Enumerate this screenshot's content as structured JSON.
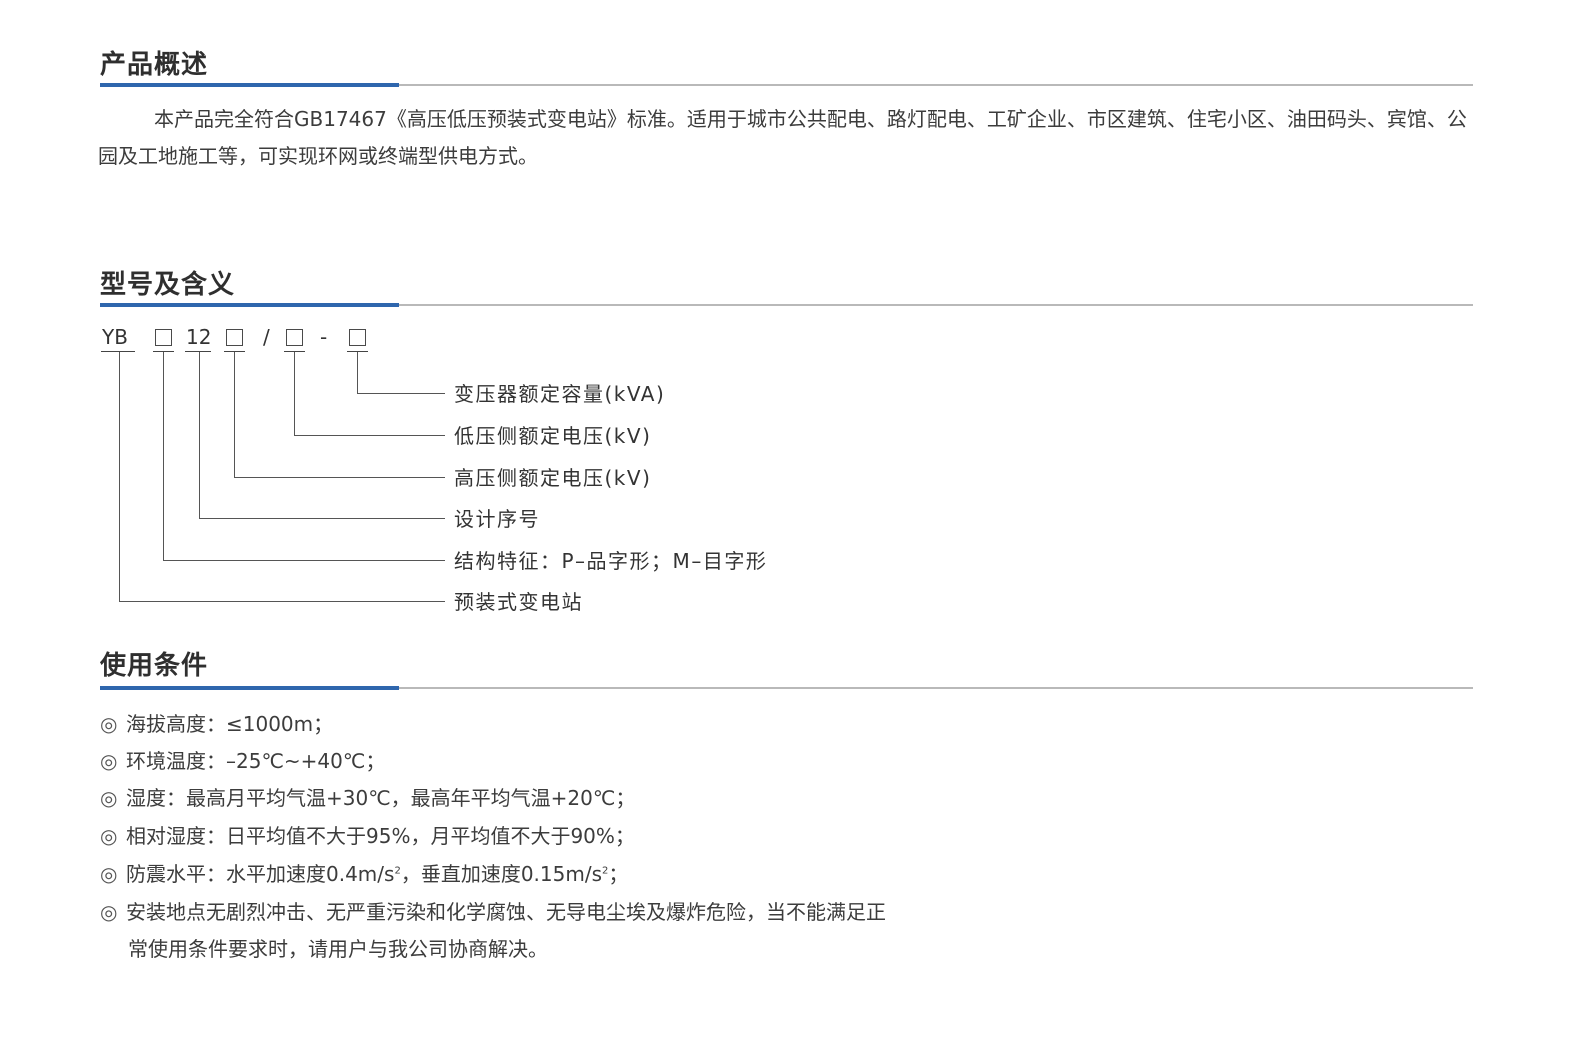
{
  "sections": {
    "overview_title": "产品概述",
    "model_title": "型号及含义",
    "conditions_title": "使用条件"
  },
  "overview": {
    "text": "本产品完全符合GB17467《高压低压预装式变电站》标准。适用于城市公共配电、路灯配电、工矿企业、市区建筑、住宅小区、油田码头、宾馆、公园及工地施工等，可实现环网或终端型供电方式。"
  },
  "model_code": {
    "prefix": "YB",
    "number": "12",
    "slash": "/",
    "dash": "-",
    "placeholder_glyph": "□",
    "meanings": [
      "变压器额定容量(kVA)",
      "低压侧额定电压(kV)",
      "高压侧额定电压(kV)",
      "设计序号",
      "结构特征：P–品字形；M–目字形",
      "预装式变电站"
    ]
  },
  "conditions": {
    "bullet": "◎",
    "items": [
      "海拔高度：≤1000m；",
      "环境温度：–25℃~+40℃；",
      "湿度：最高月平均气温+30℃，最高年平均气温+20℃；",
      "相对湿度：日平均值不大于95%，月平均值不大于90%；"
    ],
    "seismic": {
      "label": "防震水平：水平加速度0.4m/s",
      "sup1": "2",
      "mid": "，垂直加速度0.15m/s",
      "sup2": "2",
      "end": "；"
    },
    "last_line1": "安装地点无剧烈冲击、无严重污染和化学腐蚀、无导电尘埃及爆炸危险，当不能满足正",
    "last_line2": "常使用条件要求时，请用户与我公司协商解决。"
  }
}
